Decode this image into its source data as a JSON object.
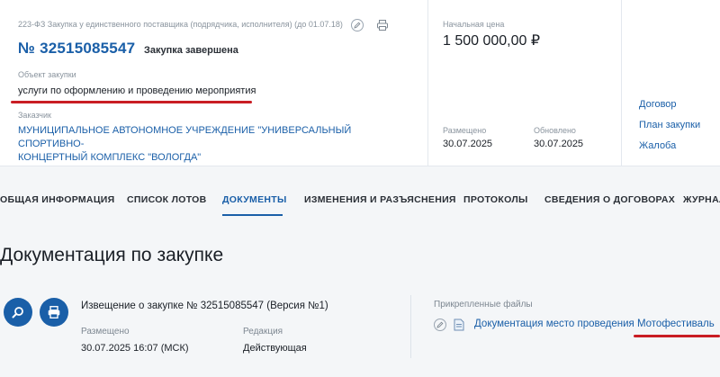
{
  "header": {
    "law_label": "223-ФЗ Закупка у единственного поставщика (подрядчика, исполнителя) (до 01.07.18)",
    "number": "№ 32515085547",
    "status": "Закупка завершена",
    "object_label": "Объект закупки",
    "object_value": "услуги по оформлению и проведению мероприятия",
    "customer_label": "Заказчик",
    "customer_line1": "МУНИЦИПАЛЬНОЕ АВТОНОМНОЕ УЧРЕЖДЕНИЕ \"УНИВЕРСАЛЬНЫЙ СПОРТИВНО-",
    "customer_line2": "КОНЦЕРТНЫЙ КОМПЛЕКС \"ВОЛОГДА\""
  },
  "price": {
    "label": "Начальная цена",
    "value": "1 500 000,00 ₽",
    "placed_label": "Размещено",
    "placed_value": "30.07.2025",
    "updated_label": "Обновлено",
    "updated_value": "30.07.2025"
  },
  "side_links": [
    "Договор",
    "План закупки",
    "Жалоба"
  ],
  "tabs": [
    "ОБЩАЯ ИНФОРМАЦИЯ",
    "СПИСОК ЛОТОВ",
    "ДОКУМЕНТЫ",
    "ИЗМЕНЕНИЯ И РАЗЪЯСНЕНИЯ",
    "ПРОТОКОЛЫ",
    "СВЕДЕНИЯ О ДОГОВОРАХ",
    "ЖУРНАЛ"
  ],
  "active_tab_index": 2,
  "section": {
    "title": "Документация по закупке",
    "notice_title": "Извещение о закупке № 32515085547 (Версия №1)",
    "placed_label": "Размещено",
    "placed_value": "30.07.2025 16:07 (МСК)",
    "edition_label": "Редакция",
    "edition_value": "Действующая",
    "attached_label": "Прикрепленные файлы",
    "file_name": "Документация место проведения Мотофестиваль"
  },
  "colors": {
    "accent": "#1a5fa8",
    "highlight_underline": "#c91d24",
    "background": "#f4f6f8"
  }
}
